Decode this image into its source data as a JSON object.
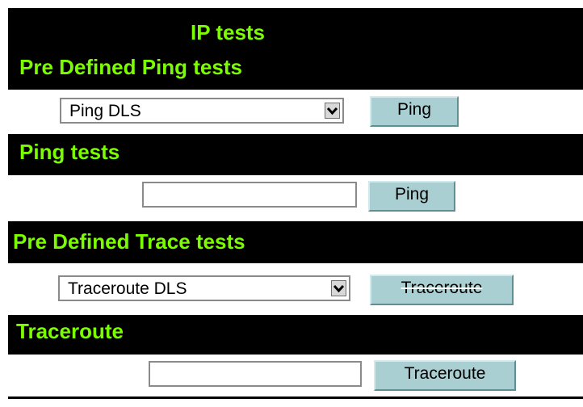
{
  "page": {
    "title": "IP tests"
  },
  "predefined_ping": {
    "heading": "Pre Defined Ping tests",
    "select_value": "Ping DLS",
    "button_label": "Ping"
  },
  "ping": {
    "heading": "Ping tests",
    "input_value": "",
    "button_label": "Ping"
  },
  "predefined_trace": {
    "heading": "Pre Defined Trace tests",
    "select_value": "Traceroute DLS",
    "button_label": "Traceroute"
  },
  "traceroute": {
    "heading": "Traceroute",
    "input_value": "",
    "button_label": "Traceroute"
  },
  "colors": {
    "background": "#000000",
    "heading_text": "#7cfc00",
    "band": "#ffffff",
    "button_face": "#a9cfd2"
  },
  "icons": {
    "dropdown": "chevron-down-icon"
  }
}
